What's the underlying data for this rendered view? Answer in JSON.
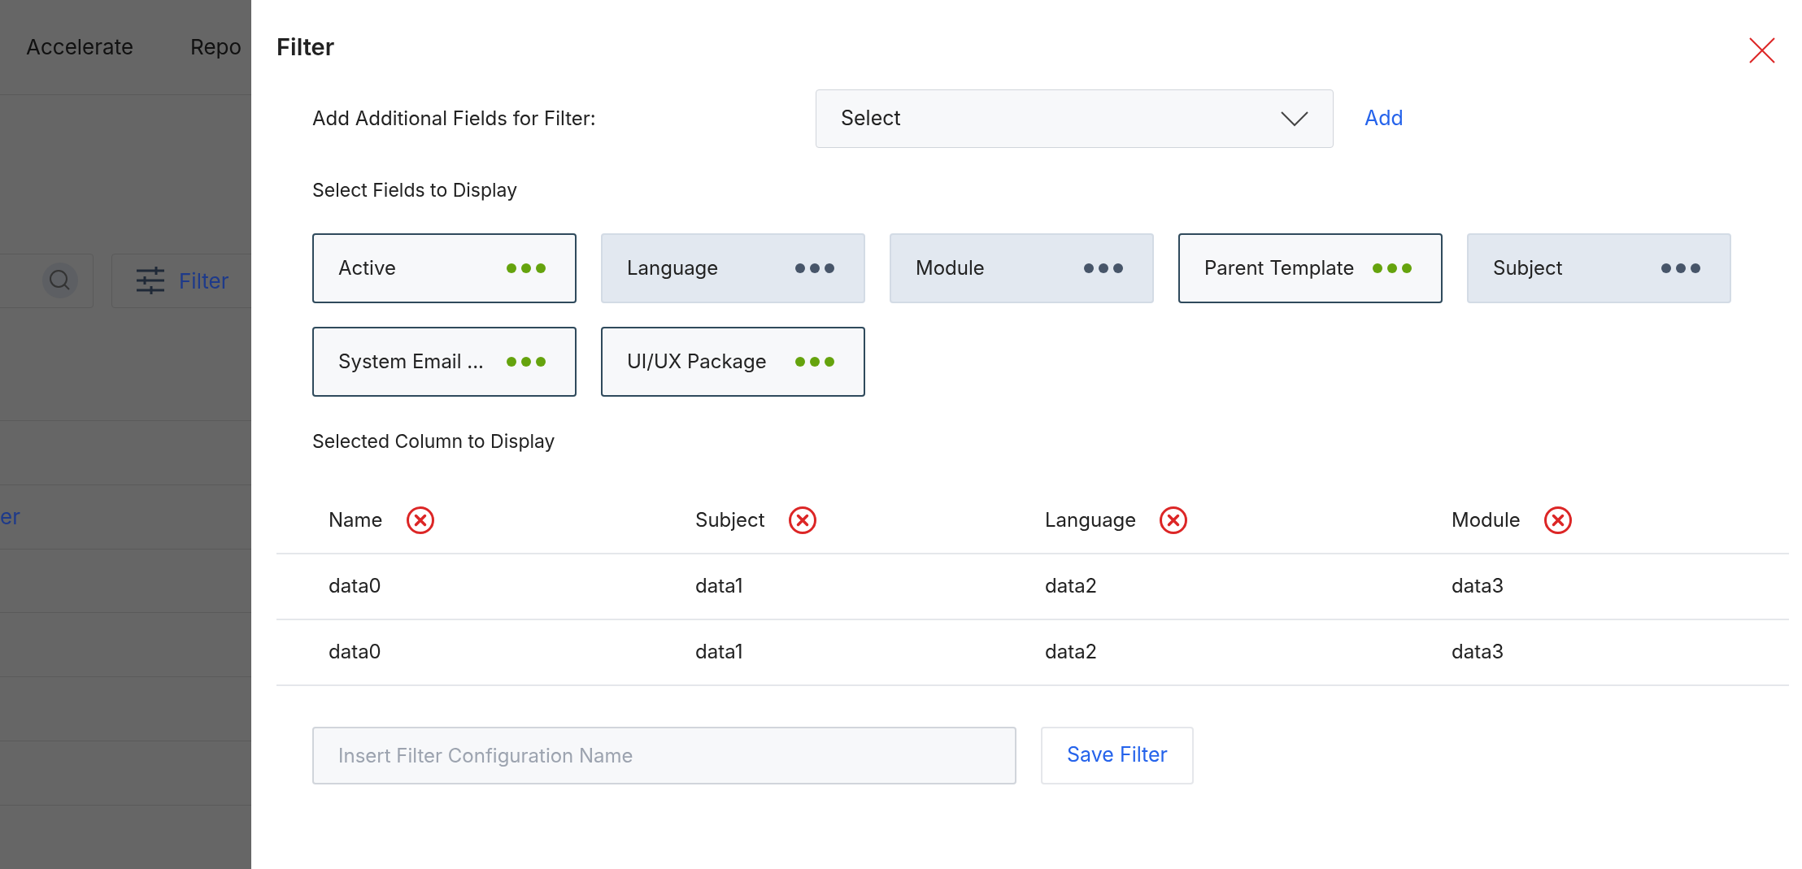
{
  "background": {
    "nav": [
      "Accelerate",
      "Repo"
    ],
    "filter_button": "Filter",
    "link": "er"
  },
  "dialog": {
    "title": "Filter",
    "add_field": {
      "label": "Add Additional Fields for Filter:",
      "select": "Select",
      "action": "Add"
    },
    "fields_heading": "Select Fields to Display",
    "fields": [
      {
        "label": "Active",
        "selected": true
      },
      {
        "label": "Language",
        "selected": false
      },
      {
        "label": "Module",
        "selected": false
      },
      {
        "label": "Parent Template",
        "selected": true
      },
      {
        "label": "Subject",
        "selected": false
      },
      {
        "label": "System Email ...",
        "selected": true
      },
      {
        "label": "UI/UX Package",
        "selected": true
      }
    ],
    "columns_heading": "Selected Column to Display",
    "table": {
      "columns": [
        "Name",
        "Subject",
        "Language",
        "Module"
      ],
      "rows": [
        [
          "data0",
          "data1",
          "data2",
          "data3"
        ],
        [
          "data0",
          "data1",
          "data2",
          "data3"
        ]
      ]
    },
    "name_field": {
      "placeholder": "Insert Filter Configuration Name"
    },
    "save_button": "Save Filter"
  }
}
